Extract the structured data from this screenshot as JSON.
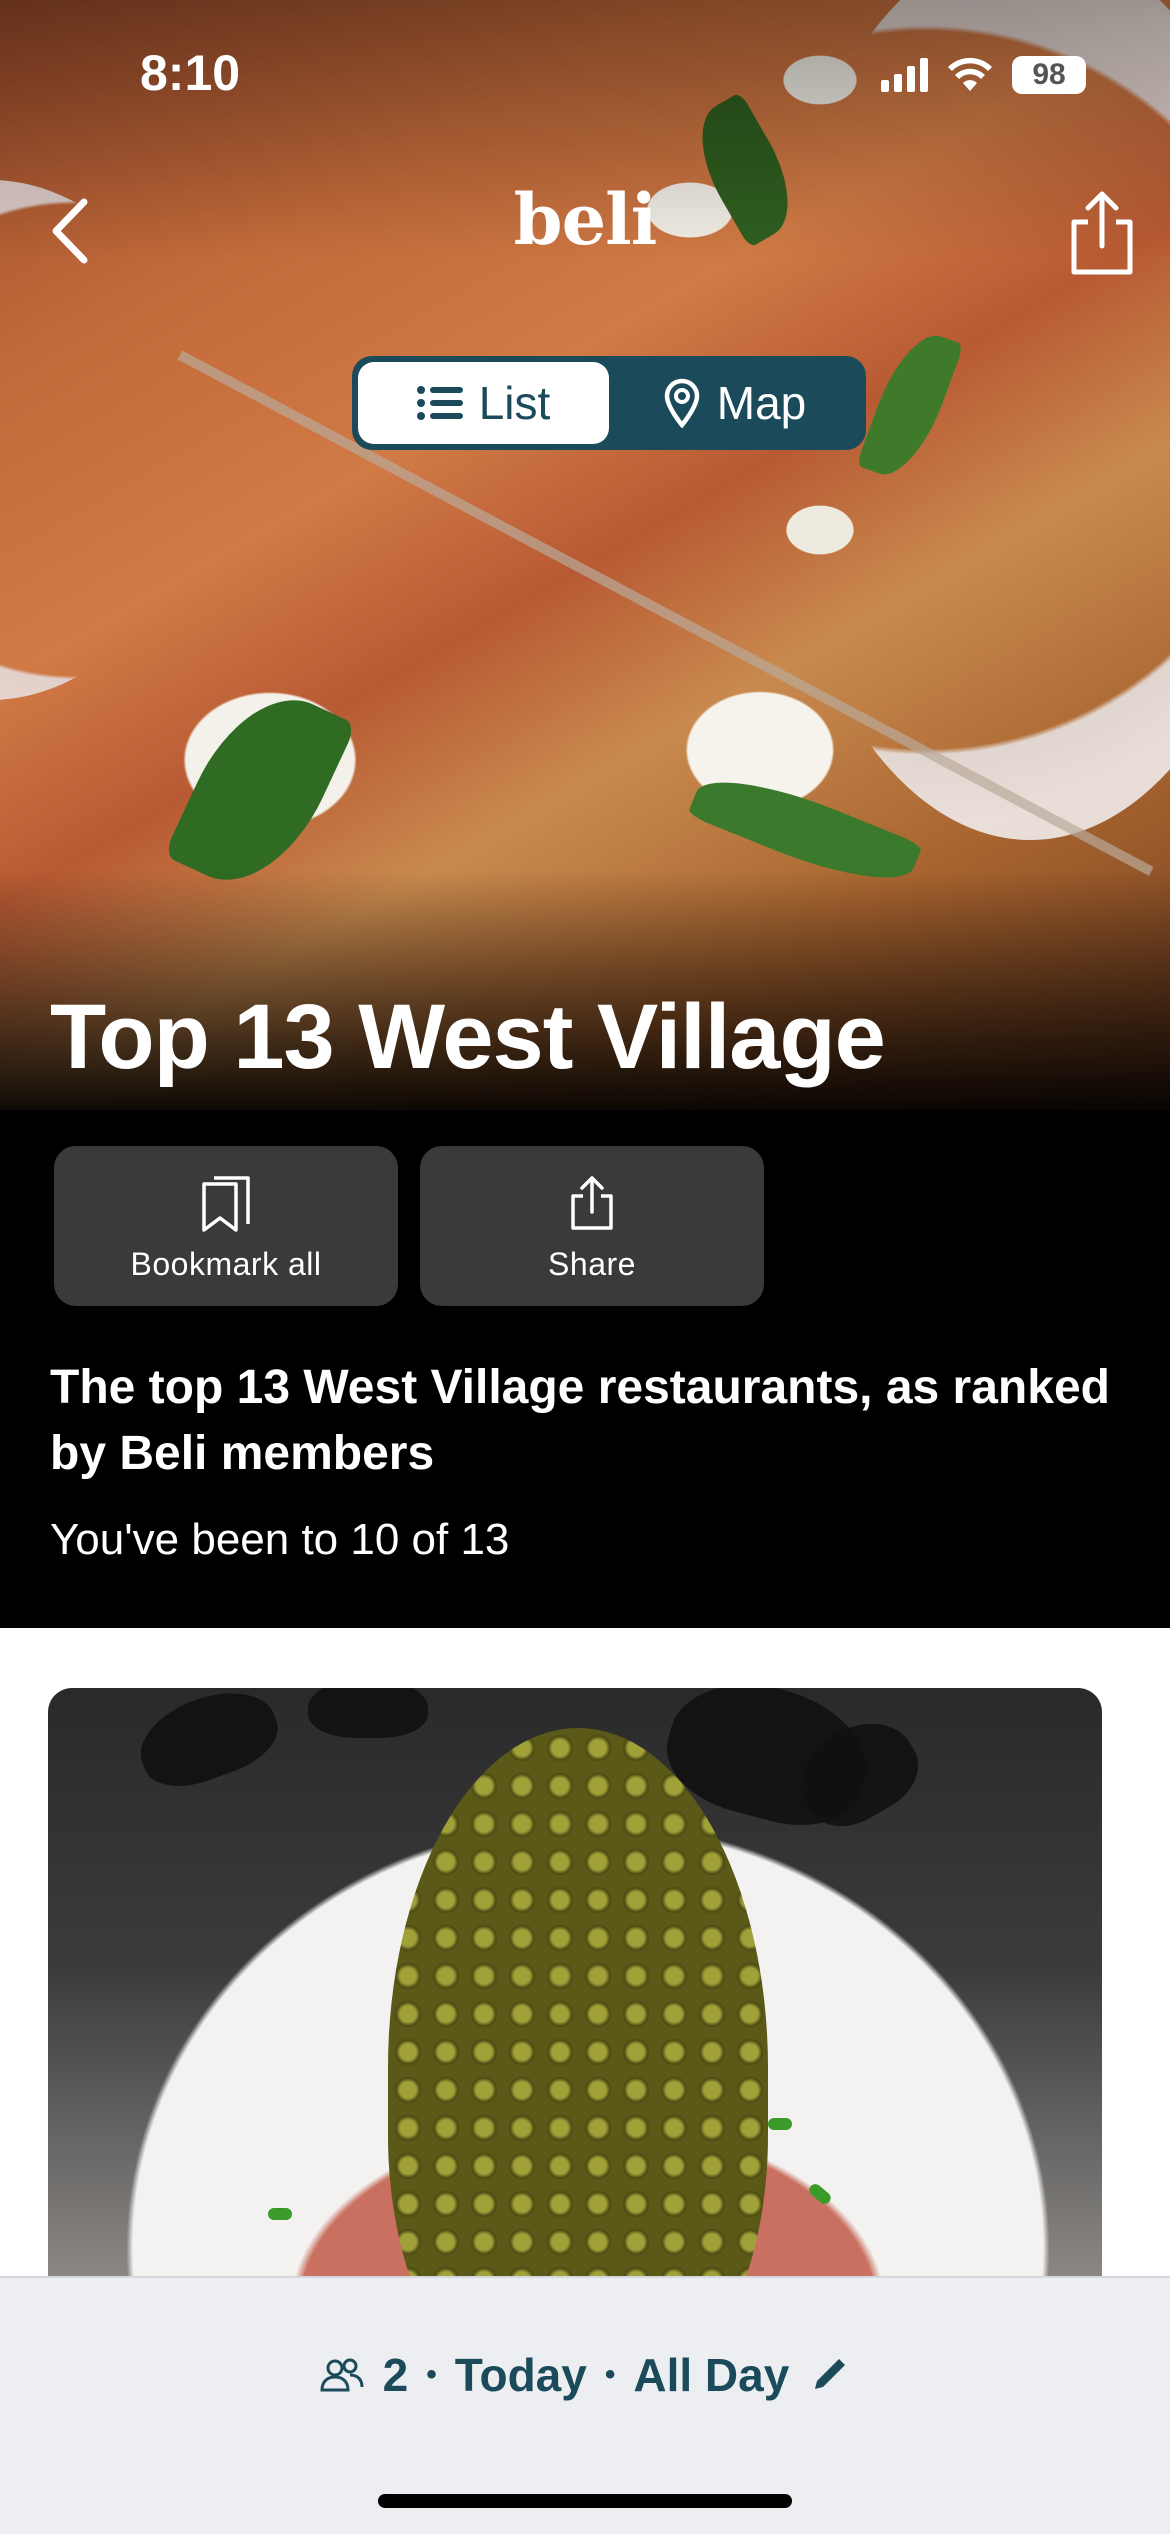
{
  "status_bar": {
    "time": "8:10",
    "battery": "98"
  },
  "nav": {
    "brand": "beli"
  },
  "view_toggle": {
    "list_label": "List",
    "map_label": "Map",
    "active": "list"
  },
  "hero": {
    "title": "Top 13 West Village"
  },
  "actions": {
    "bookmark_label": "Bookmark all",
    "share_label": "Share"
  },
  "list_info": {
    "description": "The top 13 West Village restaurants, as ranked by Beli members",
    "visited_text": "You've been to 10 of 13"
  },
  "bottom_bar": {
    "party_size": "2",
    "day": "Today",
    "time": "All Day",
    "separator": "•"
  },
  "colors": {
    "accent": "#1b4b5a",
    "card_dark": "#3a3a3c"
  }
}
